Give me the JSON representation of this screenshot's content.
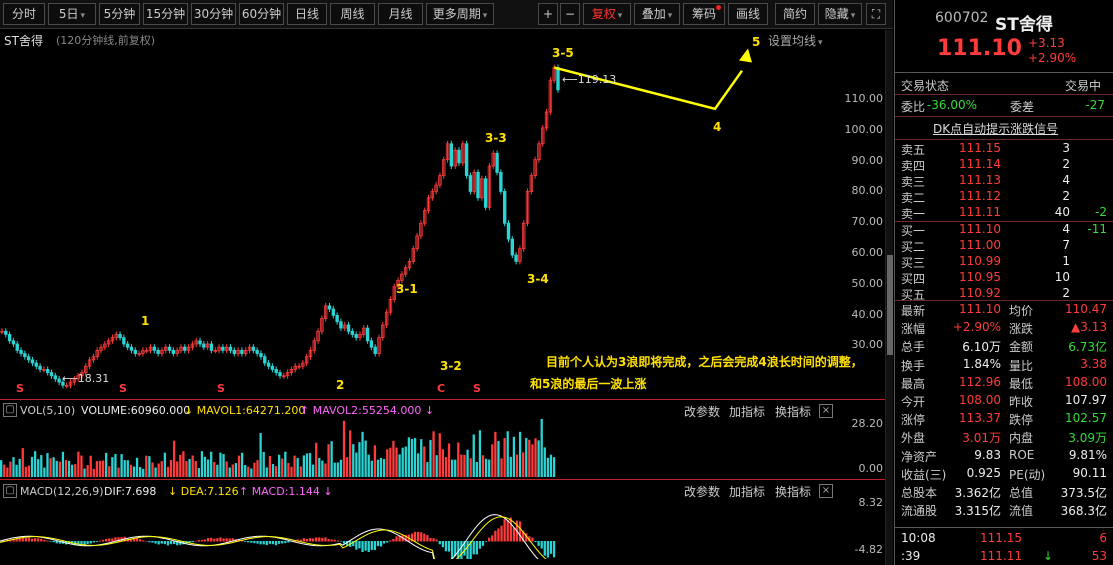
{
  "toolbar": {
    "periods": [
      "分时",
      "5日",
      "5分钟",
      "15分钟",
      "30分钟",
      "60分钟",
      "日线",
      "周线",
      "月线",
      "更多周期"
    ],
    "plus": "+",
    "minus": "−",
    "buttons": [
      "复权",
      "叠加",
      "筹码",
      "画线",
      "简约",
      "隐藏"
    ]
  },
  "chart": {
    "title": "ST舍得",
    "subtitle": "(120分钟线,前复权)",
    "settings": "设置均线",
    "y_ticks": [
      "110.00",
      "100.00",
      "90.00",
      "80.00",
      "70.00",
      "60.00",
      "50.00",
      "40.00",
      "30.00"
    ],
    "high_label": "119.13",
    "low_label": "18.31",
    "wave_labels": [
      "1",
      "2",
      "3-1",
      "3-2",
      "3-3",
      "3-4",
      "3-5",
      "4",
      "5"
    ],
    "s_markers": [
      "S",
      "S",
      "S",
      "S",
      "C"
    ],
    "annotation_line1": "目前个人认为3浪即将完成，之后会完成4浪长时间的调整，",
    "annotation_line2": "和5浪的最后一波上涨",
    "accent_color": "#ffff00"
  },
  "chart_data": {
    "type": "line",
    "xlabel": "",
    "ylabel": "",
    "ylim": [
      15,
      122
    ],
    "annotations": [
      {
        "text": "119.13",
        "type": "high"
      },
      {
        "text": "18.31",
        "type": "low"
      }
    ],
    "series": [
      {
        "values": [
          36,
          35,
          33,
          32,
          30,
          29,
          28,
          27,
          26,
          25,
          24,
          24,
          23,
          22,
          21,
          20,
          19,
          19,
          20,
          21,
          22,
          23,
          25,
          27,
          28,
          30,
          31,
          32,
          33,
          34,
          35,
          34,
          32,
          31,
          30,
          29,
          29,
          30,
          30,
          31,
          30,
          29,
          30,
          31,
          30,
          29,
          30,
          31,
          30,
          31,
          32,
          33,
          32,
          31,
          32,
          30,
          30,
          31,
          30,
          31,
          30,
          29,
          30,
          29,
          30,
          31,
          30,
          29,
          28,
          26,
          25,
          24,
          23,
          22,
          22,
          23,
          24,
          25,
          25,
          26,
          28,
          30,
          33,
          36,
          40,
          44,
          43,
          41,
          39,
          37,
          38,
          36,
          35,
          34,
          35,
          37,
          33,
          31,
          29,
          34,
          38,
          42,
          46,
          50,
          52,
          54,
          56,
          58,
          62,
          66,
          70,
          74,
          78,
          80,
          82,
          85,
          90,
          95,
          88,
          93,
          89,
          95,
          85,
          80,
          86,
          78,
          84,
          75,
          88,
          92,
          86,
          80,
          70,
          65,
          60,
          58,
          62,
          70,
          80,
          85,
          90,
          95,
          100,
          105,
          115,
          119,
          112
        ]
      }
    ]
  },
  "vol": {
    "label": "VOL(5,10)",
    "volume": "VOLUME:60960.000",
    "mavol1": "MAVOL1:64271.200",
    "mavol2": "MAVOL2:55254.000",
    "ticks": [
      "28.20",
      "0.00"
    ],
    "btn1": "改参数",
    "btn2": "加指标",
    "btn3": "换指标",
    "close": "×"
  },
  "macd": {
    "label": "MACD(12,26,9)",
    "dif": "DIF:7.698",
    "dea": "DEA:7.126",
    "macd": "MACD:1.144",
    "ticks": [
      "8.32",
      "-4.82"
    ],
    "btn1": "改参数",
    "btn2": "加指标",
    "btn3": "换指标",
    "close": "×"
  },
  "quote": {
    "code": "600702",
    "name": "ST舍得",
    "price": "111.10",
    "change": "+3.13",
    "pct": "+2.90%",
    "status_label": "交易状态",
    "status_value": "交易中",
    "weibi_label": "委比",
    "weibi": "-36.00%",
    "weicha_label": "委差",
    "weicha": "-27",
    "signal": "DK点自动提示涨跌信号",
    "asks": [
      {
        "label": "卖五",
        "price": "111.15",
        "vol": "3",
        "chg": ""
      },
      {
        "label": "卖四",
        "price": "111.14",
        "vol": "2",
        "chg": ""
      },
      {
        "label": "卖三",
        "price": "111.13",
        "vol": "4",
        "chg": ""
      },
      {
        "label": "卖二",
        "price": "111.12",
        "vol": "2",
        "chg": ""
      },
      {
        "label": "卖一",
        "price": "111.11",
        "vol": "40",
        "chg": "-2"
      }
    ],
    "bids": [
      {
        "label": "买一",
        "price": "111.10",
        "vol": "4",
        "chg": "-11"
      },
      {
        "label": "买二",
        "price": "111.00",
        "vol": "7",
        "chg": ""
      },
      {
        "label": "买三",
        "price": "110.99",
        "vol": "1",
        "chg": ""
      },
      {
        "label": "买四",
        "price": "110.95",
        "vol": "10",
        "chg": ""
      },
      {
        "label": "买五",
        "price": "110.92",
        "vol": "2",
        "chg": ""
      }
    ],
    "stats": [
      {
        "l1": "最新",
        "v1": "111.10",
        "c1": "red",
        "l2": "均价",
        "v2": "110.47",
        "c2": "red"
      },
      {
        "l1": "涨幅",
        "v1": "+2.90%",
        "c1": "red",
        "l2": "涨跌",
        "v2": "▲3.13",
        "c2": "red"
      },
      {
        "l1": "总手",
        "v1": "6.10万",
        "c1": "white",
        "l2": "金额",
        "v2": "6.73亿",
        "c2": "green"
      },
      {
        "l1": "换手",
        "v1": "1.84%",
        "c1": "white",
        "l2": "量比",
        "v2": "3.38",
        "c2": "red"
      },
      {
        "l1": "最高",
        "v1": "112.96",
        "c1": "red",
        "l2": "最低",
        "v2": "108.00",
        "c2": "red"
      },
      {
        "l1": "今开",
        "v1": "108.00",
        "c1": "red",
        "l2": "昨收",
        "v2": "107.97",
        "c2": "white"
      },
      {
        "l1": "涨停",
        "v1": "113.37",
        "c1": "red",
        "l2": "跌停",
        "v2": "102.57",
        "c2": "green"
      },
      {
        "l1": "外盘",
        "v1": "3.01万",
        "c1": "red",
        "l2": "内盘",
        "v2": "3.09万",
        "c2": "green"
      },
      {
        "l1": "净资产",
        "v1": "9.83",
        "c1": "white",
        "l2": "ROE",
        "v2": "9.81%",
        "c2": "white"
      },
      {
        "l1": "收益(三)",
        "v1": "0.925",
        "c1": "white",
        "l2": "PE(动)",
        "v2": "90.11",
        "c2": "white"
      },
      {
        "l1": "总股本",
        "v1": "3.362亿",
        "c1": "white",
        "l2": "总值",
        "v2": "373.5亿",
        "c2": "white"
      },
      {
        "l1": "流通股",
        "v1": "3.315亿",
        "c1": "white",
        "l2": "流值",
        "v2": "368.3亿",
        "c2": "white"
      }
    ],
    "ticks": [
      {
        "time": "10:08",
        "price": "111.15",
        "vol": "6",
        "arrow": ""
      },
      {
        "time": ":39",
        "price": "111.11",
        "vol": "53",
        "arrow": "↓"
      }
    ]
  }
}
